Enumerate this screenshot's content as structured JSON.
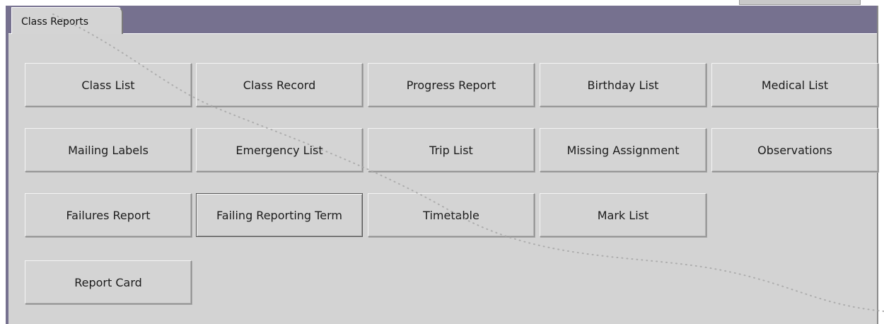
{
  "tab": {
    "label": "Class Reports"
  },
  "buttons": [
    {
      "label": "Class List"
    },
    {
      "label": "Class Record"
    },
    {
      "label": "Progress Report"
    },
    {
      "label": "Birthday List"
    },
    {
      "label": "Medical List"
    },
    {
      "label": "Mailing Labels"
    },
    {
      "label": "Emergency List"
    },
    {
      "label": "Trip List"
    },
    {
      "label": "Missing Assignment"
    },
    {
      "label": "Observations"
    },
    {
      "label": "Failures Report"
    },
    {
      "label": "Failing Reporting Term"
    },
    {
      "label": "Timetable"
    },
    {
      "label": "Mark List"
    },
    {
      "label": "Report Card"
    }
  ],
  "colors": {
    "tab_bar": "#76718f",
    "panel": "#d3d3d3",
    "button": "#d4d4d4"
  }
}
